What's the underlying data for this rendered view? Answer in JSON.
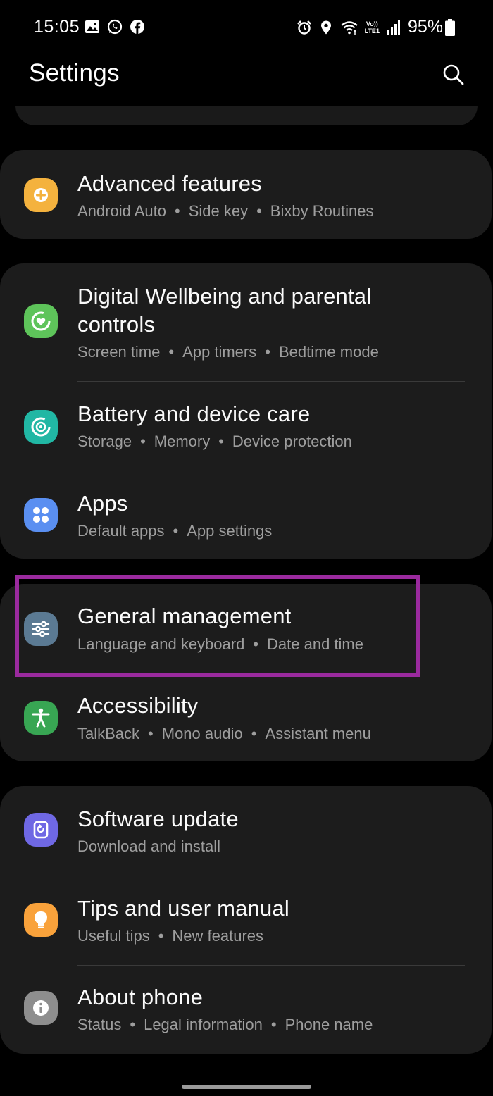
{
  "status_bar": {
    "time": "15:05",
    "left_icons": [
      "gallery-icon",
      "whatsapp-icon",
      "facebook-icon"
    ],
    "right_icons": [
      "alarm-icon",
      "location-icon",
      "wifi-icon",
      "volte-lte-icon",
      "signal-icon"
    ],
    "volte_top": "Vo))",
    "volte_bottom": "LTE1",
    "battery": "95%"
  },
  "header": {
    "title": "Settings",
    "search_icon": "search-icon"
  },
  "colors": {
    "advanced_features": "#f4b23e",
    "digital_wellbeing": "#5ec45a",
    "battery_care": "#21b7a4",
    "apps": "#5a8ff1",
    "general_management": "#5b7a93",
    "accessibility": "#38a653",
    "software_update": "#6f68e4",
    "tips": "#f9a23b",
    "about_phone": "#8e8e8e",
    "highlight": "#9a2a9e"
  },
  "items": {
    "advanced_features": {
      "title": "Advanced features",
      "subs": [
        "Android Auto",
        "Side key",
        "Bixby Routines"
      ]
    },
    "digital_wellbeing": {
      "title_line1": "Digital Wellbeing and parental",
      "title_line2": "controls",
      "subs": [
        "Screen time",
        "App timers",
        "Bedtime mode"
      ]
    },
    "battery_care": {
      "title": "Battery and device care",
      "subs": [
        "Storage",
        "Memory",
        "Device protection"
      ]
    },
    "apps": {
      "title": "Apps",
      "subs": [
        "Default apps",
        "App settings"
      ]
    },
    "general_management": {
      "title": "General management",
      "subs": [
        "Language and keyboard",
        "Date and time"
      ]
    },
    "accessibility": {
      "title": "Accessibility",
      "subs": [
        "TalkBack",
        "Mono audio",
        "Assistant menu"
      ]
    },
    "software_update": {
      "title": "Software update",
      "subs": [
        "Download and install"
      ]
    },
    "tips": {
      "title": "Tips and user manual",
      "subs": [
        "Useful tips",
        "New features"
      ]
    },
    "about_phone": {
      "title": "About phone",
      "subs": [
        "Status",
        "Legal information",
        "Phone name"
      ]
    }
  },
  "separator": "•"
}
